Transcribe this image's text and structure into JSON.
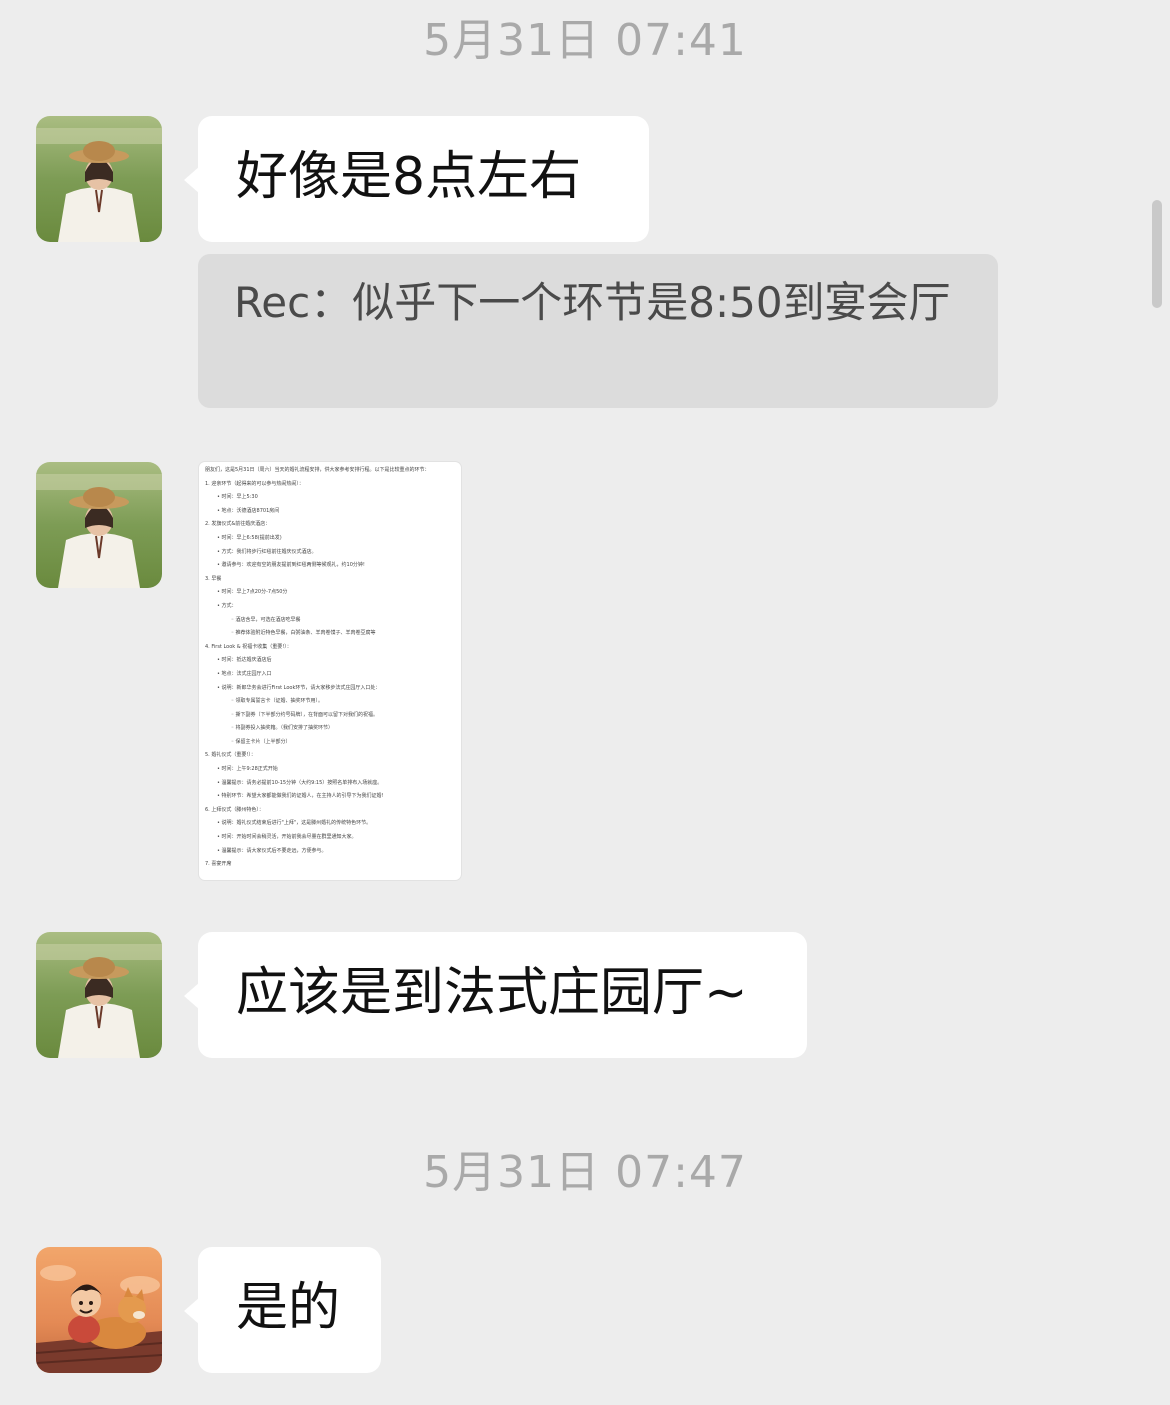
{
  "messages": {
    "timestamp_1": "5月31日  07:41",
    "msg_1": "好像是8点左右",
    "quote": "Rec：似乎下一个环节是8:50到宴会厅",
    "msg_2": "应该是到法式庄园厅~",
    "timestamp_2": "5月31日  07:47",
    "msg_3": "是的"
  },
  "document_image": {
    "lines": [
      {
        "level": 0,
        "text": "朋友们，这是5月31日（周六）当天的婚礼流程安排，供大家参考安排行程。以下是比较重点的环节："
      },
      {
        "level": 0,
        "text": "1. 迎亲环节（起得来的可以参与热闹热闹）："
      },
      {
        "level": 1,
        "text": "• 时间：早上5:30"
      },
      {
        "level": 1,
        "text": "• 地点：沃德酒店8701房间"
      },
      {
        "level": 0,
        "text": "2. 发旗仪式&前往婚庆酒店："
      },
      {
        "level": 1,
        "text": "• 时间：早上6:58(提前出发)"
      },
      {
        "level": 1,
        "text": "• 方式：我们将步行红毯前往婚庆仪式酒店。"
      },
      {
        "level": 1,
        "text": "• 邀请参与：欢迎有空的朋友提前到红毯两侧等候观礼，约10分钟!"
      },
      {
        "level": 0,
        "text": "3. 早餐"
      },
      {
        "level": 1,
        "text": "• 时间：早上7点20分-7点50分"
      },
      {
        "level": 1,
        "text": "• 方式："
      },
      {
        "level": 2,
        "text": "◦ 酒店含早，可选在酒店吃早餐"
      },
      {
        "level": 2,
        "text": "◦ 推荐体验附近特色早餐，白粥油条、羊肉卷馍子、羊肉卷豆腐等"
      },
      {
        "level": 0,
        "text": "4. First Look & 祝福卡收集（重要!）："
      },
      {
        "level": 1,
        "text": "• 时间：抵达婚庆酒店后"
      },
      {
        "level": 1,
        "text": "• 地点：法式庄园厅入口"
      },
      {
        "level": 1,
        "text": "• 说明：新郎华务会进行First Look环节，请大家移步法式庄园厅入口处："
      },
      {
        "level": 2,
        "text": "◦ 领取专属誓言卡（证婚、抽奖环节用）。"
      },
      {
        "level": 2,
        "text": "◦ 撕下副券（下半部分约号码牌），在背面可以留下对我们的祝福。"
      },
      {
        "level": 2,
        "text": "◦ 将副券投入抽奖箱。（我们安排了抽奖环节）"
      },
      {
        "level": 2,
        "text": "◦ 保留主卡片（上半部分）"
      },
      {
        "level": 0,
        "text": "5. 婚礼仪式（重要!）："
      },
      {
        "level": 1,
        "text": "• 时间：上午9:28正式开始"
      },
      {
        "level": 1,
        "text": "• 温馨提示：请务必提前10-15分钟（大约9:15）按照名单排布入场就座。"
      },
      {
        "level": 1,
        "text": "• 特别环节：希望大家都能做我们的证婚人，在主持人的引导下为我们证婚!"
      },
      {
        "level": 0,
        "text": "6. 上拜仪式（滕州特色）："
      },
      {
        "level": 1,
        "text": "• 说明：婚礼仪式结束后进行\"上拜\"，这是滕州婚礼的传统特色环节。"
      },
      {
        "level": 1,
        "text": "• 时间：开始时间会稍灵活，开始前我会尽量在群里通知大家。"
      },
      {
        "level": 1,
        "text": "• 温馨提示：请大家仪式后不要走远，方便参与。"
      },
      {
        "level": 0,
        "text": "7. 喜宴开席"
      }
    ]
  },
  "colors": {
    "background": "#ededed",
    "bubble": "#ffffff",
    "quote": "#dcdcdc",
    "timestamp": "#a9a9a9"
  }
}
